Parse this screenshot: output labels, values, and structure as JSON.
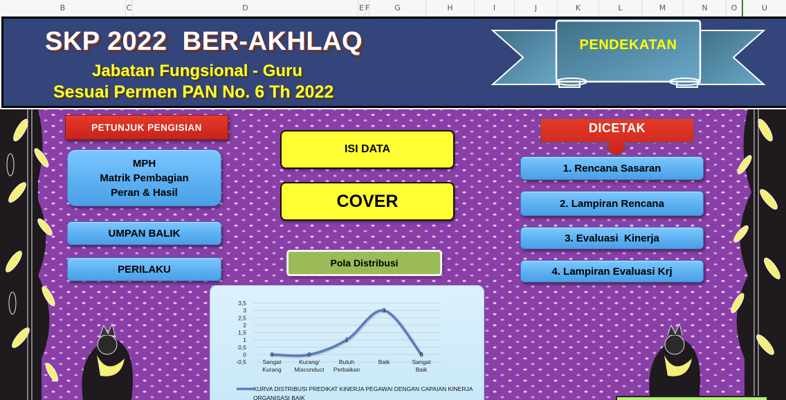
{
  "spreadsheet": {
    "columns": [
      "B",
      "C",
      "D",
      "E",
      "F",
      "G",
      "H",
      "I",
      "J",
      "K",
      "L",
      "M",
      "N",
      "O",
      "U"
    ]
  },
  "banner": {
    "title": "SKP 2022  BER-AKHLAQ",
    "subtitle_1": "Jabatan Fungsional - Guru",
    "subtitle_2": "Sesuai Permen PAN No. 6 Th 2022",
    "ribbon_button": "PENDEKATAN"
  },
  "left_panel": {
    "heading": "PETUNJUK PENGISIAN",
    "mph_button": {
      "line1": "MPH",
      "line2": "Matrik Pembagian",
      "line3": "Peran & Hasil"
    },
    "umpan_balik_button": "UMPAN BALIK",
    "perilaku_button": "PERILAKU"
  },
  "center_panel": {
    "isi_data_button": "ISI DATA",
    "cover_button": "COVER",
    "pola_distribusi_button": "Pola Distribusi"
  },
  "right_panel": {
    "heading": "DICETAK",
    "print_buttons": [
      "1. Rencana Sasaran",
      "2. Lampiran Rencana",
      "3. Evaluasi  Kinerja",
      "4. Lampiran Evaluasi Krj"
    ]
  },
  "colors": {
    "banner_bg": "#33457a",
    "title_text": "#ffffff",
    "subtitle_text": "#ffff33",
    "red_button": "#d42a1e",
    "blue_button": "#5aaef0",
    "yellow_button": "#ffff33",
    "green_button": "#9bbb59",
    "series_line": "#5b7bc0",
    "batik_purple": "#8a3fa8"
  },
  "chart_data": {
    "type": "line",
    "smooth": true,
    "title": "",
    "xlabel": "",
    "ylabel": "",
    "categories": [
      [
        "Sangat",
        "Kurang"
      ],
      [
        "Kurang/",
        "Misconduct"
      ],
      [
        "Butuh",
        "Perbaikan"
      ],
      [
        "Baik"
      ],
      [
        "Sangat",
        "Baik"
      ]
    ],
    "series": [
      {
        "name": "KURVA DISTRIBUSI PREDIKAT KINERJA PEGAWAI DENGAN CAPAIAN KINERJA ORGANISASI BAIK",
        "legend_lines": [
          "KURVA DISTRIBUSI PREDIKAT KINERJA PEGAWAI DENGAN CAPAIAN KINERJA",
          "ORGANISASI BAIK"
        ],
        "values": [
          0,
          0,
          1,
          3,
          0
        ],
        "data_labels": [
          "0",
          "0",
          "1",
          "3",
          "0"
        ]
      }
    ],
    "ylim": [
      -0.5,
      3.5
    ],
    "yticks": [
      -0.5,
      0,
      0.5,
      1,
      1.5,
      2,
      2.5,
      3,
      3.5
    ],
    "ytick_labels": [
      "-0,5",
      "0",
      "0,5",
      "1",
      "1,5",
      "2",
      "2,5",
      "3",
      "3,5"
    ],
    "grid": true,
    "legend_position": "bottom"
  }
}
